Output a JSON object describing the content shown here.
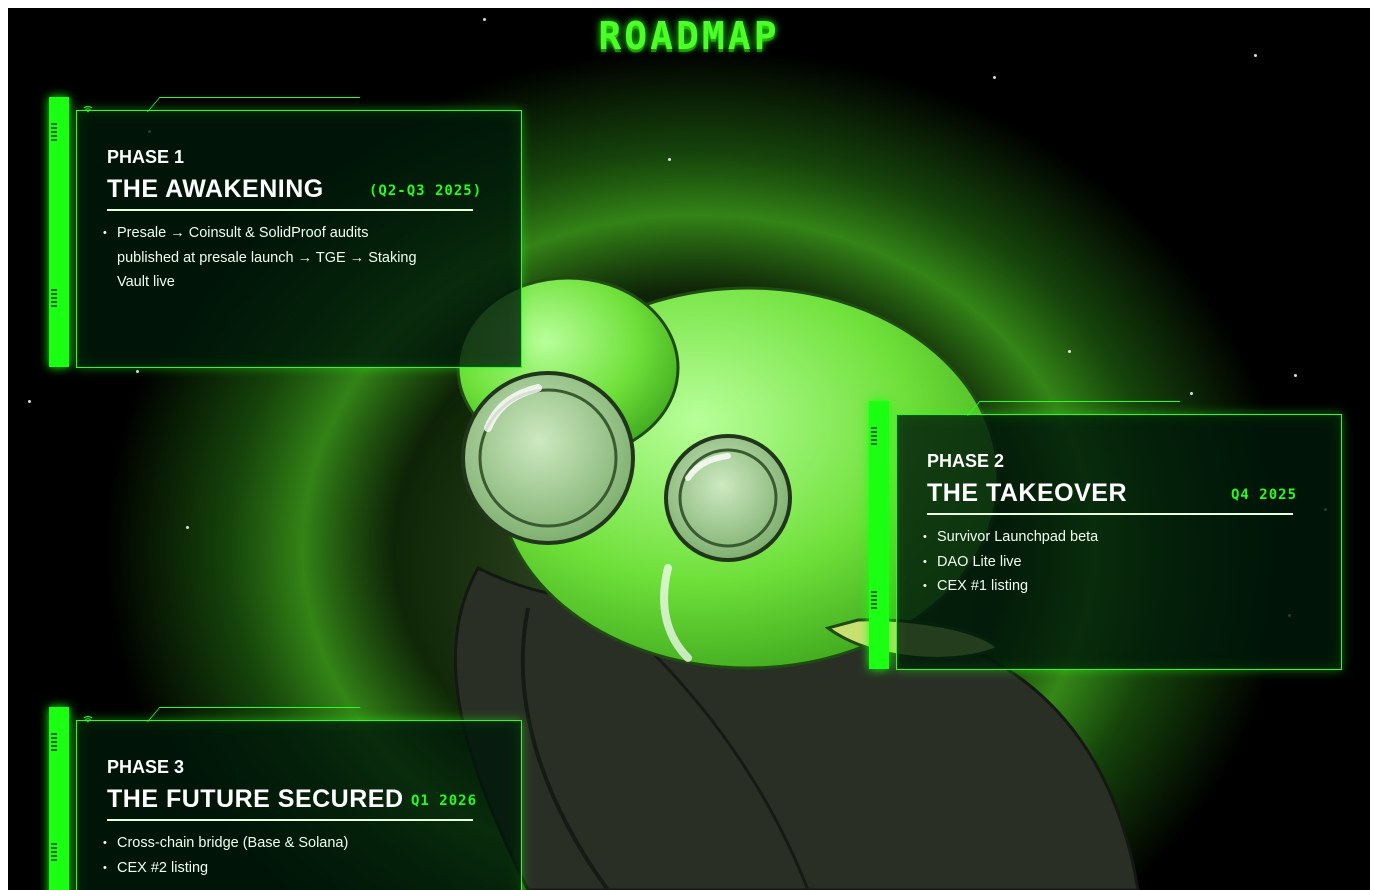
{
  "page": {
    "title": "ROADMAP"
  },
  "phases": [
    {
      "phase": "PHASE 1",
      "name": "THE AWAKENING",
      "date": "(Q2-Q3 2025)",
      "items": [
        "Presale → Coinsult & SolidProof audits",
        "published at presale launch → TGE → Staking",
        "Vault live"
      ]
    },
    {
      "phase": "PHASE 2",
      "name": "THE TAKEOVER",
      "date": "Q4 2025",
      "items": [
        "Survivor Launchpad beta",
        "DAO Lite live",
        "CEX #1 listing"
      ]
    },
    {
      "phase": "PHASE 3",
      "name": "THE FUTURE SECURED",
      "date": "Q1 2026",
      "items": [
        "Cross-chain bridge (Base & Solana)",
        "CEX #2 listing"
      ]
    }
  ],
  "colors": {
    "accent": "#2aff1a",
    "background": "#000000",
    "text": "#ffffff"
  },
  "icons": [
    "wifi-icon"
  ]
}
